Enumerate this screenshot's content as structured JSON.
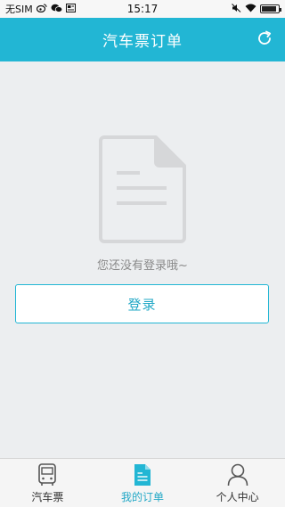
{
  "status_bar": {
    "carrier": "无SIM",
    "time": "15:17",
    "icons": [
      "weibo-icon",
      "wechat-icon",
      "news-icon",
      "mute-icon",
      "wifi-icon",
      "battery-icon"
    ],
    "battery_level": 0.9
  },
  "header": {
    "title": "汽车票订单",
    "refresh_icon": "refresh-icon"
  },
  "empty_state": {
    "icon": "document-icon",
    "message": "您还没有登录哦~",
    "login_label": "登录"
  },
  "tab_bar": {
    "items": [
      {
        "label": "汽车票",
        "icon": "bus-icon",
        "active": false
      },
      {
        "label": "我的订单",
        "icon": "order-document-icon",
        "active": true
      },
      {
        "label": "个人中心",
        "icon": "person-icon",
        "active": false
      }
    ]
  },
  "colors": {
    "accent": "#22b6d4",
    "background": "#eceef0",
    "muted_text": "#8a8a8a"
  }
}
